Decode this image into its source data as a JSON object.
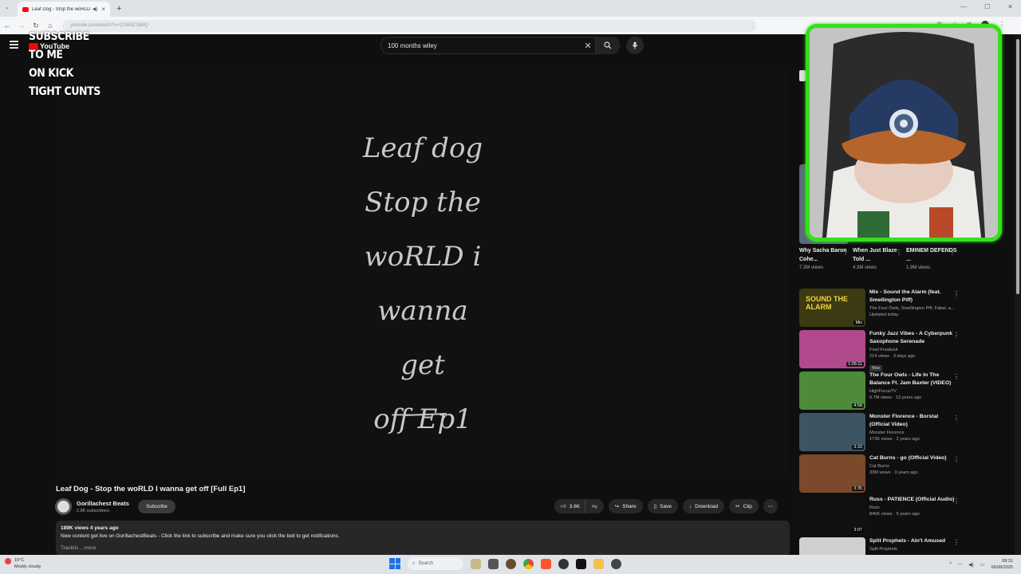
{
  "browser": {
    "tab_title": "Leaf Dog - Stop the woRLD",
    "url": "youtube.com/watch?v=t21lK6Z1B8Q"
  },
  "overlay_lines": [
    "SUBSCRIBE",
    "TO ME",
    "ON KICK",
    "TIGHT CUNTS"
  ],
  "youtube": {
    "logo_text": "YouTube",
    "search_value": "100 months wiley"
  },
  "video": {
    "art_lines": [
      "Leaf dog",
      "Stop the",
      "woRLD i",
      "wanna get",
      "off Ep1"
    ],
    "title": "Leaf Dog - Stop the woRLD I wanna get off [Full Ep1]",
    "channel_name": "Gorillachest Beats",
    "subscribers": "2.8K subscribers",
    "subscribe_label": "Subscribe",
    "likes": "3.6K",
    "share_label": "Share",
    "save_label": "Save",
    "download_label": "Download",
    "clip_label": "Clip",
    "description_meta": "189K views  4 years ago",
    "description_text": "New content get live on GorillachestBeats - Click the link to subscribe and make sure you click the bell to get notifications.",
    "description_more": "Tracklis  ...more"
  },
  "shorts": [
    {
      "title": "Why Sacha Baron Cohe...",
      "views": "7.3M views"
    },
    {
      "title": "When Just Blaze Told ...",
      "views": "4.3M views"
    },
    {
      "title": "EMINEM DEFENDS ...",
      "views": "1.9M views"
    }
  ],
  "recommended": [
    {
      "title": "Mix - Sound the Alarm (feat. Smellington Piff)",
      "channel": "The Four Owls, Smellington Piff, Fabel, a...",
      "meta": "Updated today",
      "duration": "Mix",
      "thumb_color": "#3b3a12",
      "thumb_text": "SOUND THE ALARM"
    },
    {
      "title": "Funky Jazz Vibes - A Cyberpunk Saxophone Serenade",
      "channel": "Fowl Freakout",
      "meta": "214 views · 3 days ago",
      "badge": "New",
      "duration": "1:05:11",
      "thumb_color": "#b04a8c"
    },
    {
      "title": "The Four Owls - Life In The Balance Ft. Jam Baxter (VIDEO)",
      "channel": "HighFocusTV",
      "meta": "6.7M views · 13 years ago",
      "duration": "4:58",
      "thumb_color": "#4d8a3a"
    },
    {
      "title": "Monster Florence - Borstal (Official Video)",
      "channel": "Monster Florence",
      "meta": "173K views · 2 years ago",
      "duration": "3:33",
      "thumb_color": "#3d5563"
    },
    {
      "title": "Cat Burns - go (Official Video)",
      "channel": "Cat Burns",
      "meta": "33M views · 3 years ago",
      "duration": "3:35",
      "thumb_color": "#7a4a2a"
    },
    {
      "title": "Russ - PATIENCE (Official Audio)",
      "channel": "Russ",
      "meta": "840K views · 5 years ago",
      "duration": "3:07",
      "thumb_color": "#111111"
    },
    {
      "title": "Split Prophets - Ain't Amused",
      "channel": "Split Prophets",
      "meta": "",
      "duration": "",
      "thumb_color": "#cfcfcf"
    }
  ],
  "taskbar": {
    "weather_temp": "15°C",
    "weather_desc": "Mostly cloudy",
    "search_label": "Search",
    "time": "08:31",
    "date": "06/08/2025"
  },
  "colors": {
    "webcam_border": "#34e01c",
    "youtube_red": "#ff0000",
    "background": "#0f0f0f"
  }
}
